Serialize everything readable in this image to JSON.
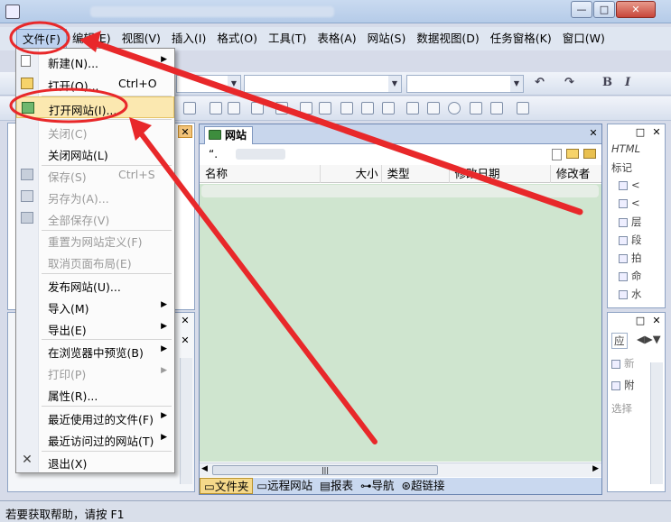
{
  "window": {
    "controls": {
      "minimize": "—",
      "maximize": "□",
      "close": "✕"
    }
  },
  "menubar": {
    "items": [
      "文件(F)",
      "编辑(E)",
      "视图(V)",
      "插入(I)",
      "格式(O)",
      "工具(T)",
      "表格(A)",
      "网站(S)",
      "数据视图(D)",
      "任务窗格(K)",
      "窗口(W)"
    ]
  },
  "toolbar": {
    "undo_glyph": "↶",
    "redo_glyph": "↷",
    "bold": "B",
    "italic": "I"
  },
  "file_menu": {
    "items": [
      {
        "label": "新建(N)...",
        "shortcut": "",
        "submenu": true,
        "disabled": false,
        "icon": "new-page-icon"
      },
      {
        "label": "打开(O)...",
        "shortcut": "Ctrl+O",
        "submenu": false,
        "disabled": false,
        "icon": "open-folder-icon"
      },
      {
        "label": "打开网站(I)...",
        "shortcut": "",
        "submenu": false,
        "disabled": false,
        "icon": "open-site-icon",
        "highlighted": true
      },
      {
        "label": "关闭(C)",
        "shortcut": "",
        "submenu": false,
        "disabled": true,
        "icon": ""
      },
      {
        "label": "关闭网站(L)",
        "shortcut": "",
        "submenu": false,
        "disabled": false,
        "icon": ""
      },
      {
        "label": "保存(S)",
        "shortcut": "Ctrl+S",
        "submenu": false,
        "disabled": true,
        "icon": "save-icon"
      },
      {
        "label": "另存为(A)...",
        "shortcut": "",
        "submenu": false,
        "disabled": true,
        "icon": "save-as-icon"
      },
      {
        "label": "全部保存(V)",
        "shortcut": "",
        "submenu": false,
        "disabled": true,
        "icon": "save-all-icon"
      },
      {
        "label": "重置为网站定义(F)",
        "shortcut": "",
        "submenu": false,
        "disabled": true,
        "icon": ""
      },
      {
        "label": "取消页面布局(E)",
        "shortcut": "",
        "submenu": false,
        "disabled": true,
        "icon": ""
      },
      {
        "label": "发布网站(U)...",
        "shortcut": "",
        "submenu": false,
        "disabled": false,
        "icon": ""
      },
      {
        "label": "导入(M)",
        "shortcut": "",
        "submenu": true,
        "disabled": false,
        "icon": ""
      },
      {
        "label": "导出(E)",
        "shortcut": "",
        "submenu": true,
        "disabled": false,
        "icon": ""
      },
      {
        "label": "在浏览器中预览(B)",
        "shortcut": "",
        "submenu": true,
        "disabled": false,
        "icon": ""
      },
      {
        "label": "打印(P)",
        "shortcut": "",
        "submenu": true,
        "disabled": true,
        "icon": ""
      },
      {
        "label": "属性(R)...",
        "shortcut": "",
        "submenu": false,
        "disabled": false,
        "icon": ""
      },
      {
        "label": "最近使用过的文件(F)",
        "shortcut": "",
        "submenu": true,
        "disabled": false,
        "icon": ""
      },
      {
        "label": "最近访问过的网站(T)",
        "shortcut": "",
        "submenu": true,
        "disabled": false,
        "icon": ""
      },
      {
        "label": "退出(X)",
        "shortcut": "",
        "submenu": false,
        "disabled": false,
        "icon": "exit-x-icon"
      }
    ]
  },
  "main": {
    "tab_label": "网站",
    "path": "“.",
    "columns": [
      "名称",
      "大小",
      "类型",
      "修改日期",
      "修改者"
    ],
    "bottom_tabs": [
      "文件夹",
      "远程网站",
      "报表",
      "导航",
      "超链接"
    ]
  },
  "right_panel_top": {
    "header": "HTML",
    "label": "标记",
    "items": [
      "<",
      "<",
      "层",
      "段",
      "拍",
      "命",
      "水"
    ]
  },
  "right_panel_bottom": {
    "tab": "应",
    "items": [
      "新",
      "附",
      "选择"
    ]
  },
  "statusbar": {
    "text": "若要获取帮助，请按 F1"
  },
  "colors": {
    "annotation_red": "#e8282a",
    "menu_highlight": "#fbe8b0",
    "list_background": "#cfe5cf"
  }
}
